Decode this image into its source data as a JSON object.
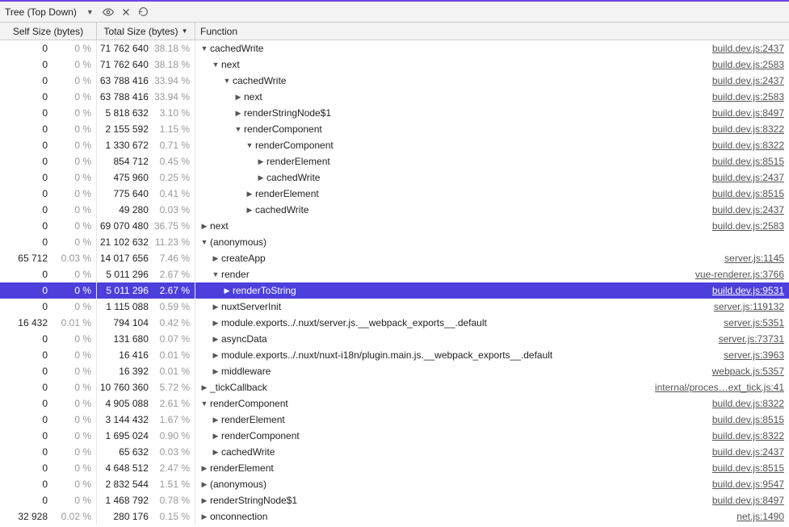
{
  "toolbar": {
    "mode_label": "Tree (Top Down)"
  },
  "columns": {
    "self": "Self Size (bytes)",
    "total": "Total Size (bytes)",
    "fn": "Function"
  },
  "rows": [
    {
      "self": "0",
      "self_pct": "0 %",
      "total": "71 762 640",
      "total_pct": "38.18 %",
      "depth": 0,
      "state": "open",
      "name": "cachedWrite",
      "link": "build.dev.js:2437"
    },
    {
      "self": "0",
      "self_pct": "0 %",
      "total": "71 762 640",
      "total_pct": "38.18 %",
      "depth": 1,
      "state": "open",
      "name": "next",
      "link": "build.dev.js:2583"
    },
    {
      "self": "0",
      "self_pct": "0 %",
      "total": "63 788 416",
      "total_pct": "33.94 %",
      "depth": 2,
      "state": "open",
      "name": "cachedWrite",
      "link": "build.dev.js:2437"
    },
    {
      "self": "0",
      "self_pct": "0 %",
      "total": "63 788 416",
      "total_pct": "33.94 %",
      "depth": 3,
      "state": "closed",
      "name": "next",
      "link": "build.dev.js:2583"
    },
    {
      "self": "0",
      "self_pct": "0 %",
      "total": "5 818 632",
      "total_pct": "3.10 %",
      "depth": 3,
      "state": "closed",
      "name": "renderStringNode$1",
      "link": "build.dev.js:8497"
    },
    {
      "self": "0",
      "self_pct": "0 %",
      "total": "2 155 592",
      "total_pct": "1.15 %",
      "depth": 3,
      "state": "open",
      "name": "renderComponent",
      "link": "build.dev.js:8322"
    },
    {
      "self": "0",
      "self_pct": "0 %",
      "total": "1 330 672",
      "total_pct": "0.71 %",
      "depth": 4,
      "state": "open",
      "name": "renderComponent",
      "link": "build.dev.js:8322"
    },
    {
      "self": "0",
      "self_pct": "0 %",
      "total": "854 712",
      "total_pct": "0.45 %",
      "depth": 5,
      "state": "closed",
      "name": "renderElement",
      "link": "build.dev.js:8515"
    },
    {
      "self": "0",
      "self_pct": "0 %",
      "total": "475 960",
      "total_pct": "0.25 %",
      "depth": 5,
      "state": "closed",
      "name": "cachedWrite",
      "link": "build.dev.js:2437"
    },
    {
      "self": "0",
      "self_pct": "0 %",
      "total": "775 640",
      "total_pct": "0.41 %",
      "depth": 4,
      "state": "closed",
      "name": "renderElement",
      "link": "build.dev.js:8515"
    },
    {
      "self": "0",
      "self_pct": "0 %",
      "total": "49 280",
      "total_pct": "0.03 %",
      "depth": 4,
      "state": "closed",
      "name": "cachedWrite",
      "link": "build.dev.js:2437"
    },
    {
      "self": "0",
      "self_pct": "0 %",
      "total": "69 070 480",
      "total_pct": "36.75 %",
      "depth": 0,
      "state": "closed",
      "name": "next",
      "link": "build.dev.js:2583"
    },
    {
      "self": "0",
      "self_pct": "0 %",
      "total": "21 102 632",
      "total_pct": "11.23 %",
      "depth": 0,
      "state": "open",
      "name": "(anonymous)",
      "link": ""
    },
    {
      "self": "65 712",
      "self_pct": "0.03 %",
      "total": "14 017 656",
      "total_pct": "7.46 %",
      "depth": 1,
      "state": "closed",
      "name": "createApp",
      "link": "server.js:1145"
    },
    {
      "self": "0",
      "self_pct": "0 %",
      "total": "5 011 296",
      "total_pct": "2.67 %",
      "depth": 1,
      "state": "open",
      "name": "render",
      "link": "vue-renderer.js:3766"
    },
    {
      "self": "0",
      "self_pct": "0 %",
      "total": "5 011 296",
      "total_pct": "2.67 %",
      "depth": 2,
      "state": "closed",
      "name": "renderToString",
      "link": "build.dev.js:9531",
      "selected": true
    },
    {
      "self": "0",
      "self_pct": "0 %",
      "total": "1 115 088",
      "total_pct": "0.59 %",
      "depth": 1,
      "state": "closed",
      "name": "nuxtServerInit",
      "link": "server.js:119132"
    },
    {
      "self": "16 432",
      "self_pct": "0.01 %",
      "total": "794 104",
      "total_pct": "0.42 %",
      "depth": 1,
      "state": "closed",
      "name": "module.exports../.nuxt/server.js.__webpack_exports__.default",
      "link": "server.js:5351"
    },
    {
      "self": "0",
      "self_pct": "0 %",
      "total": "131 680",
      "total_pct": "0.07 %",
      "depth": 1,
      "state": "closed",
      "name": "asyncData",
      "link": "server.js:73731"
    },
    {
      "self": "0",
      "self_pct": "0 %",
      "total": "16 416",
      "total_pct": "0.01 %",
      "depth": 1,
      "state": "closed",
      "name": "module.exports../.nuxt/nuxt-i18n/plugin.main.js.__webpack_exports__.default",
      "link": "server.js:3963"
    },
    {
      "self": "0",
      "self_pct": "0 %",
      "total": "16 392",
      "total_pct": "0.01 %",
      "depth": 1,
      "state": "closed",
      "name": "middleware",
      "link": "webpack.js:5357"
    },
    {
      "self": "0",
      "self_pct": "0 %",
      "total": "10 760 360",
      "total_pct": "5.72 %",
      "depth": 0,
      "state": "closed",
      "name": "_tickCallback",
      "link": "internal/proces…ext_tick.js:41"
    },
    {
      "self": "0",
      "self_pct": "0 %",
      "total": "4 905 088",
      "total_pct": "2.61 %",
      "depth": 0,
      "state": "open",
      "name": "renderComponent",
      "link": "build.dev.js:8322"
    },
    {
      "self": "0",
      "self_pct": "0 %",
      "total": "3 144 432",
      "total_pct": "1.67 %",
      "depth": 1,
      "state": "closed",
      "name": "renderElement",
      "link": "build.dev.js:8515"
    },
    {
      "self": "0",
      "self_pct": "0 %",
      "total": "1 695 024",
      "total_pct": "0.90 %",
      "depth": 1,
      "state": "closed",
      "name": "renderComponent",
      "link": "build.dev.js:8322"
    },
    {
      "self": "0",
      "self_pct": "0 %",
      "total": "65 632",
      "total_pct": "0.03 %",
      "depth": 1,
      "state": "closed",
      "name": "cachedWrite",
      "link": "build.dev.js:2437"
    },
    {
      "self": "0",
      "self_pct": "0 %",
      "total": "4 648 512",
      "total_pct": "2.47 %",
      "depth": 0,
      "state": "closed",
      "name": "renderElement",
      "link": "build.dev.js:8515"
    },
    {
      "self": "0",
      "self_pct": "0 %",
      "total": "2 832 544",
      "total_pct": "1.51 %",
      "depth": 0,
      "state": "closed",
      "name": "(anonymous)",
      "link": "build.dev.js:9547"
    },
    {
      "self": "0",
      "self_pct": "0 %",
      "total": "1 468 792",
      "total_pct": "0.78 %",
      "depth": 0,
      "state": "closed",
      "name": "renderStringNode$1",
      "link": "build.dev.js:8497"
    },
    {
      "self": "32 928",
      "self_pct": "0.02 %",
      "total": "280 176",
      "total_pct": "0.15 %",
      "depth": 0,
      "state": "closed",
      "name": "onconnection",
      "link": "net.js:1490"
    }
  ]
}
